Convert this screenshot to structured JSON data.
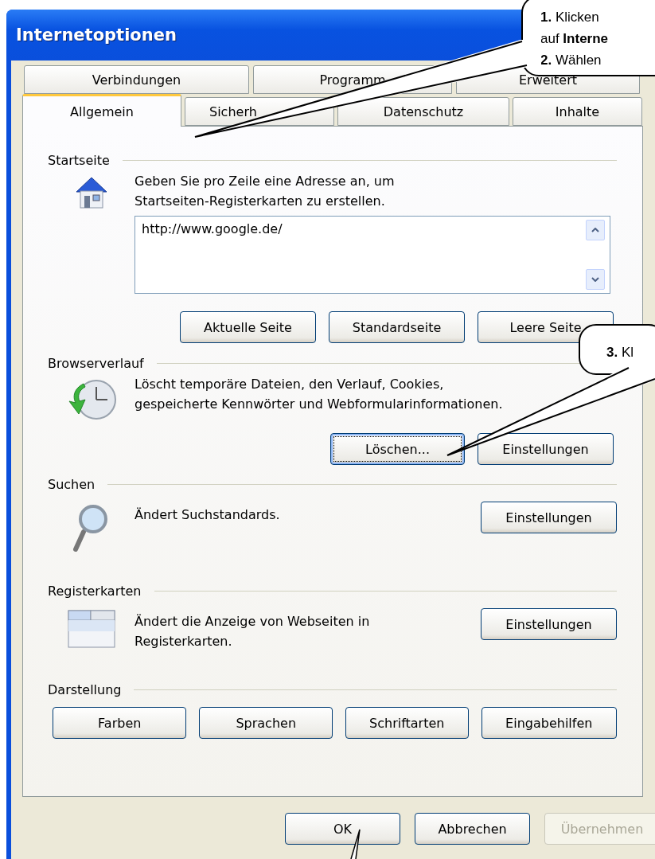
{
  "window": {
    "title": "Internetoptionen"
  },
  "tab_rows": [
    [
      {
        "label": "Verbindungen",
        "selected": false
      },
      {
        "label": "Programm",
        "selected": false
      },
      {
        "label": "Erweitert",
        "selected": false
      }
    ],
    [
      {
        "label": "Allgemein",
        "selected": true
      },
      {
        "label": "Sicherh",
        "selected": false
      },
      {
        "label": "Datenschutz",
        "selected": false
      },
      {
        "label": "Inhalte",
        "selected": false
      }
    ]
  ],
  "sections": [
    {
      "kind": "homepage",
      "title": "Startseite",
      "text": "Geben Sie pro Zeile eine Adresse an, um Startseiten-Registerkarten zu erstellen.",
      "field": {
        "value": "http://www.google.de/"
      },
      "buttons": [
        {
          "label": "Aktuelle Seite",
          "focused": false
        },
        {
          "label": "Standardseite",
          "focused": false
        },
        {
          "label": "Leere Seite",
          "focused": false
        }
      ]
    },
    {
      "kind": "history",
      "title": "Browserverlauf",
      "text": "Löscht temporäre Dateien, den Verlauf, Cookies, gespeicherte Kennwörter und Webformularinformationen.",
      "buttons": [
        {
          "label": "Löschen...",
          "focused": true
        },
        {
          "label": "Einstellungen",
          "focused": false
        }
      ]
    },
    {
      "kind": "search",
      "title": "Suchen",
      "text": "Ändert Suchstandards.",
      "buttons": [
        {
          "label": "Einstellungen",
          "focused": false
        }
      ]
    },
    {
      "kind": "tabs",
      "title": "Registerkarten",
      "text": "Ändert die Anzeige von Webseiten in Registerkarten.",
      "buttons": [
        {
          "label": "Einstellungen",
          "focused": false
        }
      ]
    },
    {
      "kind": "appearance",
      "title": "Darstellung",
      "buttons": [
        {
          "label": "Farben",
          "focused": false
        },
        {
          "label": "Sprachen",
          "focused": false
        },
        {
          "label": "Schriftarten",
          "focused": false
        },
        {
          "label": "Eingabehilfen",
          "focused": false
        }
      ]
    }
  ],
  "footer_buttons": [
    {
      "label": "OK",
      "disabled": false
    },
    {
      "label": "Abbrechen",
      "disabled": false
    },
    {
      "label": "Übernehmen",
      "disabled": true
    }
  ],
  "callouts": [
    {
      "kind": "top",
      "lines": [
        "**1.** Klicken",
        "auf **Interne**",
        "**2.** Wählen"
      ]
    },
    {
      "kind": "middle",
      "lines": [
        "**3.** Kl"
      ]
    }
  ]
}
